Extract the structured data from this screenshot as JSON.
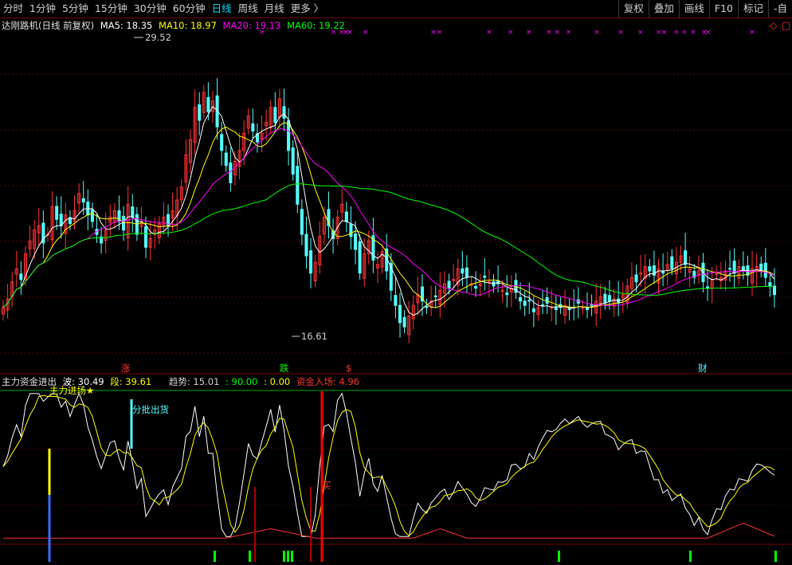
{
  "toolbar": {
    "periods": [
      "分时",
      "1分钟",
      "5分钟",
      "15分钟",
      "30分钟",
      "60分钟",
      "日线",
      "周线",
      "月线",
      "更多 〉"
    ],
    "active_period": "日线",
    "buttons": [
      "复权",
      "叠加",
      "画线",
      "F10",
      "标记",
      "-自"
    ]
  },
  "main_legend": {
    "title": "达刚路机(日线 前复权)",
    "ma5": "MA5: 18.35",
    "ma10": "MA10: 18.97",
    "ma20": "MA20: 19.13",
    "ma60": "MA60: 19.22"
  },
  "annotations": {
    "high": "29.52",
    "low": "16.61",
    "signal_zhang": "涨",
    "signal_die": "跌",
    "signal_dollar": "$",
    "signal_cai": "财"
  },
  "indicator_legend": {
    "name": "主力资金进出",
    "bo": "波: 30.49",
    "duan": "段: 39.61",
    "qushi": "趋势: 15.01",
    "v90": ": 90.00",
    "v0": ": 0.00",
    "zijin": "资金入场: 4.96"
  },
  "indicator_labels": {
    "zhuli": "主力进场★",
    "fenpi": "分批出货",
    "mai": "买"
  },
  "colors": {
    "up": "#ff3333",
    "down": "#54ffff",
    "ma5": "#ffffff",
    "ma10": "#ffff00",
    "ma20": "#ff00ff",
    "ma60": "#00ff00",
    "active": "#00e0ff"
  },
  "chart_data": {
    "type": "candlestick",
    "close": [
      17.8,
      18.2,
      19.0,
      19.6,
      19.1,
      20.3,
      20.9,
      21.4,
      21.6,
      20.8,
      21.2,
      22.5,
      21.9,
      21.6,
      22.1,
      21.7,
      22.3,
      23.1,
      22.7,
      22.1,
      21.8,
      21.2,
      20.8,
      21.4,
      22.0,
      22.3,
      21.8,
      21.4,
      22.6,
      22.0,
      21.2,
      21.8,
      20.6,
      21.0,
      21.4,
      21.7,
      22.0,
      21.6,
      22.3,
      22.8,
      23.4,
      24.9,
      25.6,
      27.1,
      26.5,
      27.8,
      26.9,
      27.4,
      26.2,
      25.1,
      24.4,
      23.6,
      24.6,
      25.1,
      25.9,
      26.7,
      26.0,
      25.5,
      25.9,
      26.4,
      27.1,
      26.4,
      27.5,
      26.6,
      25.1,
      24.0,
      22.6,
      21.2,
      20.2,
      19.4,
      19.9,
      21.1,
      22.0,
      21.6,
      21.0,
      22.0,
      22.6,
      21.8,
      21.1,
      20.5,
      19.4,
      20.3,
      20.9,
      20.0,
      19.8,
      20.4,
      19.5,
      18.6,
      17.9,
      17.1,
      16.9,
      17.4,
      17.9,
      18.4,
      18.1,
      17.8,
      18.1,
      18.3,
      18.6,
      18.9,
      18.7,
      19.1,
      19.6,
      19.4,
      19.2,
      18.9,
      18.7,
      18.9,
      19.2,
      19.0,
      18.8,
      18.9,
      18.6,
      18.4,
      18.7,
      18.5,
      18.1,
      17.9,
      18.1,
      17.6,
      17.8,
      17.9,
      18.0,
      17.8,
      17.7,
      17.8,
      17.9,
      17.7,
      17.8,
      18.0,
      17.8,
      17.7,
      17.9,
      18.1,
      18.3,
      18.0,
      18.1,
      18.2,
      18.0,
      18.4,
      18.8,
      19.2,
      19.0,
      19.4,
      19.7,
      19.5,
      19.3,
      19.6,
      19.4,
      19.8,
      19.6,
      19.9,
      20.2,
      19.8,
      19.6,
      19.2,
      19.5,
      19.0,
      18.7,
      19.1,
      19.4,
      19.2,
      19.5,
      19.6,
      19.4,
      19.7,
      19.5,
      19.3,
      19.6,
      19.7,
      19.5,
      19.2,
      18.8,
      18.4
    ],
    "high": 29.52,
    "low": 16.61
  }
}
